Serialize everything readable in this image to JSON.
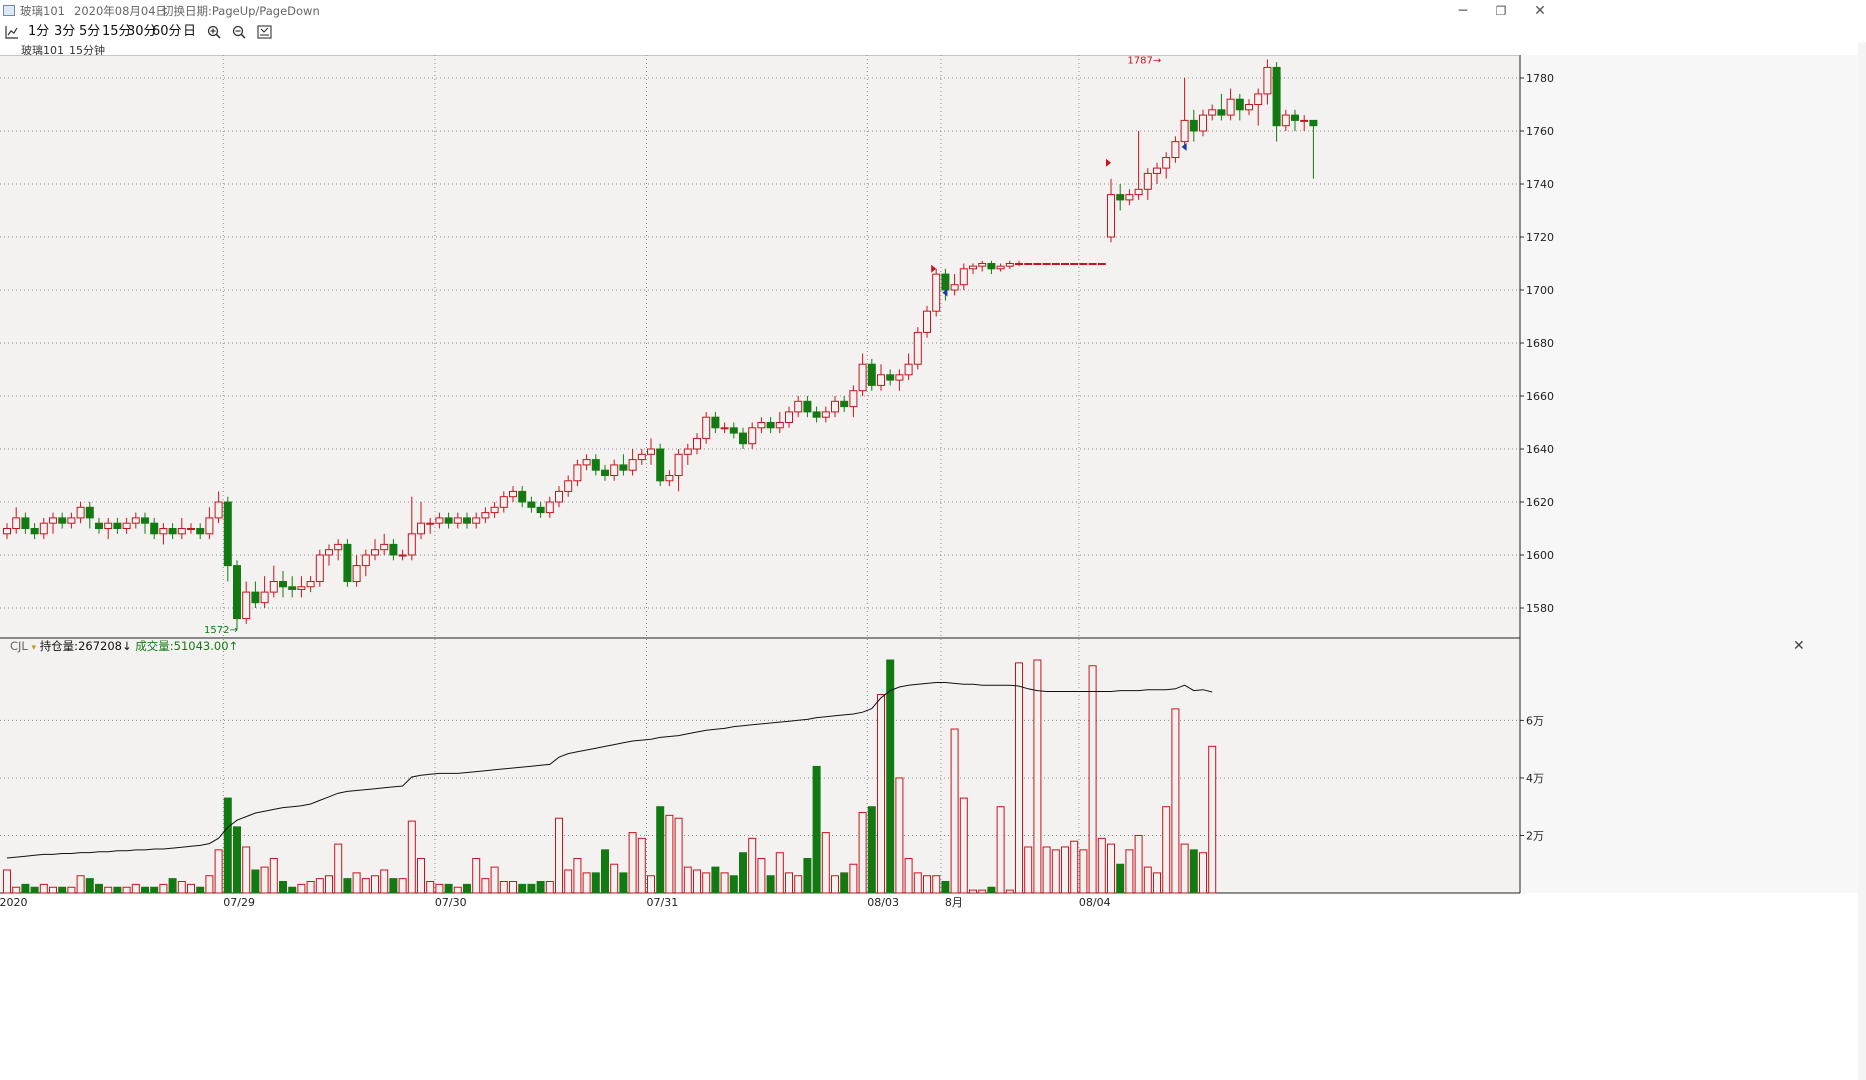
{
  "window": {
    "symbol": "玻璃101",
    "date": "2020年08月04日",
    "hint": "切换日期:PageUp/PageDown",
    "minimize": "─",
    "restore": "❐",
    "close": "✕"
  },
  "toolbar": {
    "chart_icon": "chart-line-icon",
    "periods": [
      "1分",
      "3分",
      "5分",
      "15分",
      "30分",
      "60分",
      "日"
    ],
    "zoom_in_icon": "zoom-in-icon",
    "zoom_out_icon": "zoom-out-icon",
    "fit_icon": "fit-screen-icon"
  },
  "subbar": {
    "symbol": "玻璃101",
    "period": "15分钟"
  },
  "volume_panel": {
    "indicator": "CJL",
    "oi_label": "持仓量:",
    "oi_value": "267208",
    "oi_arrow": "↓",
    "vol_label": "成交量:",
    "vol_value": "51043.00",
    "vol_arrow": "↑",
    "close_icon": "✕"
  },
  "colors": {
    "up": "#c8141e",
    "down": "#137a13",
    "background": "#f3f2f0",
    "grid": "#888888"
  },
  "chart_data": [
    {
      "type": "candlestick",
      "x_labels": [
        "2020",
        "07/29",
        "07/30",
        "07/31",
        "08/03",
        "8月",
        "08/04"
      ],
      "y_ticks": [
        1580,
        1600,
        1620,
        1640,
        1660,
        1680,
        1700,
        1720,
        1740,
        1760,
        1780
      ],
      "ylim": [
        1570,
        1791
      ],
      "grid": true,
      "annotations": [
        {
          "text": "1787→",
          "value": 1787
        },
        {
          "text": "1572→",
          "value": 1572
        }
      ],
      "candles": [
        [
          1608,
          1610,
          1606,
          1612
        ],
        [
          1610,
          1614,
          1608,
          1618
        ],
        [
          1614,
          1610,
          1608,
          1616
        ],
        [
          1610,
          1608,
          1606,
          1612
        ],
        [
          1608,
          1612,
          1606,
          1614
        ],
        [
          1612,
          1614,
          1608,
          1616
        ],
        [
          1614,
          1612,
          1610,
          1616
        ],
        [
          1612,
          1614,
          1610,
          1616
        ],
        [
          1614,
          1618,
          1612,
          1620
        ],
        [
          1618,
          1614,
          1610,
          1620
        ],
        [
          1612,
          1610,
          1608,
          1614
        ],
        [
          1610,
          1612,
          1606,
          1614
        ],
        [
          1612,
          1610,
          1608,
          1614
        ],
        [
          1610,
          1612,
          1608,
          1614
        ],
        [
          1612,
          1614,
          1610,
          1616
        ],
        [
          1614,
          1612,
          1608,
          1616
        ],
        [
          1612,
          1608,
          1606,
          1614
        ],
        [
          1608,
          1610,
          1604,
          1612
        ],
        [
          1610,
          1608,
          1606,
          1612
        ],
        [
          1608,
          1610,
          1606,
          1614
        ],
        [
          1610,
          1610,
          1608,
          1612
        ],
        [
          1610,
          1608,
          1606,
          1612
        ],
        [
          1608,
          1614,
          1606,
          1618
        ],
        [
          1614,
          1620,
          1612,
          1624
        ],
        [
          1620,
          1596,
          1590,
          1622
        ],
        [
          1596,
          1576,
          1572,
          1598
        ],
        [
          1576,
          1586,
          1574,
          1590
        ],
        [
          1586,
          1582,
          1580,
          1590
        ],
        [
          1582,
          1586,
          1580,
          1592
        ],
        [
          1586,
          1590,
          1584,
          1596
        ],
        [
          1590,
          1588,
          1584,
          1594
        ],
        [
          1588,
          1587,
          1584,
          1592
        ],
        [
          1587,
          1588,
          1584,
          1592
        ],
        [
          1588,
          1590,
          1586,
          1592
        ],
        [
          1590,
          1600,
          1588,
          1602
        ],
        [
          1600,
          1602,
          1596,
          1604
        ],
        [
          1602,
          1604,
          1598,
          1606
        ],
        [
          1604,
          1590,
          1588,
          1606
        ],
        [
          1590,
          1596,
          1588,
          1600
        ],
        [
          1596,
          1600,
          1592,
          1602
        ],
        [
          1600,
          1602,
          1598,
          1606
        ],
        [
          1602,
          1604,
          1600,
          1608
        ],
        [
          1604,
          1600,
          1598,
          1606
        ],
        [
          1600,
          1600,
          1598,
          1602
        ],
        [
          1600,
          1608,
          1598,
          1622
        ],
        [
          1608,
          1612,
          1606,
          1620
        ],
        [
          1612,
          1612,
          1608,
          1614
        ],
        [
          1612,
          1614,
          1610,
          1616
        ],
        [
          1614,
          1612,
          1610,
          1616
        ],
        [
          1612,
          1614,
          1610,
          1616
        ],
        [
          1614,
          1612,
          1610,
          1616
        ],
        [
          1612,
          1614,
          1610,
          1616
        ],
        [
          1614,
          1616,
          1612,
          1618
        ],
        [
          1616,
          1618,
          1614,
          1620
        ],
        [
          1618,
          1622,
          1616,
          1624
        ],
        [
          1622,
          1624,
          1620,
          1626
        ],
        [
          1624,
          1620,
          1618,
          1626
        ],
        [
          1620,
          1618,
          1616,
          1622
        ],
        [
          1618,
          1616,
          1614,
          1620
        ],
        [
          1616,
          1620,
          1614,
          1622
        ],
        [
          1620,
          1624,
          1618,
          1626
        ],
        [
          1624,
          1628,
          1622,
          1630
        ],
        [
          1628,
          1634,
          1626,
          1636
        ],
        [
          1634,
          1636,
          1632,
          1638
        ],
        [
          1636,
          1632,
          1630,
          1638
        ],
        [
          1632,
          1630,
          1628,
          1634
        ],
        [
          1630,
          1634,
          1628,
          1636
        ],
        [
          1634,
          1632,
          1630,
          1638
        ],
        [
          1632,
          1636,
          1630,
          1640
        ],
        [
          1636,
          1638,
          1634,
          1640
        ],
        [
          1638,
          1640,
          1634,
          1644
        ],
        [
          1640,
          1628,
          1626,
          1642
        ],
        [
          1628,
          1630,
          1626,
          1632
        ],
        [
          1630,
          1638,
          1624,
          1640
        ],
        [
          1638,
          1640,
          1634,
          1642
        ],
        [
          1640,
          1644,
          1638,
          1646
        ],
        [
          1644,
          1652,
          1642,
          1654
        ],
        [
          1652,
          1648,
          1646,
          1654
        ],
        [
          1648,
          1648,
          1646,
          1650
        ],
        [
          1648,
          1646,
          1644,
          1650
        ],
        [
          1646,
          1642,
          1640,
          1648
        ],
        [
          1642,
          1648,
          1640,
          1650
        ],
        [
          1648,
          1650,
          1646,
          1652
        ],
        [
          1650,
          1648,
          1646,
          1652
        ],
        [
          1648,
          1650,
          1646,
          1654
        ],
        [
          1650,
          1654,
          1648,
          1656
        ],
        [
          1654,
          1658,
          1652,
          1660
        ],
        [
          1658,
          1654,
          1652,
          1660
        ],
        [
          1654,
          1652,
          1650,
          1656
        ],
        [
          1652,
          1654,
          1650,
          1656
        ],
        [
          1654,
          1658,
          1652,
          1660
        ],
        [
          1658,
          1656,
          1654,
          1660
        ],
        [
          1656,
          1662,
          1652,
          1664
        ],
        [
          1662,
          1672,
          1660,
          1676
        ],
        [
          1672,
          1664,
          1662,
          1674
        ],
        [
          1664,
          1668,
          1662,
          1672
        ],
        [
          1668,
          1666,
          1664,
          1670
        ],
        [
          1666,
          1668,
          1662,
          1670
        ],
        [
          1668,
          1672,
          1666,
          1676
        ],
        [
          1672,
          1684,
          1670,
          1686
        ],
        [
          1684,
          1692,
          1682,
          1694
        ],
        [
          1692,
          1706,
          1690,
          1708
        ],
        [
          1706,
          1700,
          1696,
          1708
        ],
        [
          1700,
          1702,
          1698,
          1706
        ],
        [
          1702,
          1708,
          1700,
          1710
        ],
        [
          1708,
          1709,
          1706,
          1710
        ],
        [
          1709,
          1710,
          1707,
          1711
        ],
        [
          1710,
          1708,
          1706,
          1711
        ],
        [
          1708,
          1709,
          1707,
          1710
        ],
        [
          1709,
          1710,
          1708,
          1711
        ],
        [
          1710,
          1710,
          1709,
          1711
        ],
        [
          1710,
          1710,
          1710,
          1710
        ],
        [
          1710,
          1710,
          1710,
          1710
        ],
        [
          1710,
          1710,
          1710,
          1710
        ],
        [
          1710,
          1710,
          1710,
          1710
        ],
        [
          1710,
          1710,
          1710,
          1710
        ],
        [
          1710,
          1710,
          1710,
          1710
        ],
        [
          1710,
          1710,
          1710,
          1710
        ],
        [
          1710,
          1710,
          1710,
          1710
        ],
        [
          1710,
          1710,
          1710,
          1710
        ],
        [
          1720,
          1736,
          1718,
          1742
        ],
        [
          1736,
          1734,
          1730,
          1740
        ],
        [
          1734,
          1736,
          1732,
          1738
        ],
        [
          1736,
          1738,
          1734,
          1760
        ],
        [
          1738,
          1744,
          1734,
          1746
        ],
        [
          1744,
          1746,
          1740,
          1748
        ],
        [
          1746,
          1750,
          1742,
          1752
        ],
        [
          1750,
          1756,
          1748,
          1758
        ],
        [
          1756,
          1764,
          1754,
          1780
        ],
        [
          1764,
          1760,
          1756,
          1768
        ],
        [
          1760,
          1766,
          1758,
          1768
        ],
        [
          1766,
          1768,
          1764,
          1770
        ],
        [
          1768,
          1766,
          1764,
          1774
        ],
        [
          1766,
          1772,
          1764,
          1776
        ],
        [
          1772,
          1768,
          1764,
          1774
        ],
        [
          1768,
          1770,
          1766,
          1772
        ],
        [
          1770,
          1774,
          1762,
          1776
        ],
        [
          1774,
          1784,
          1770,
          1787
        ],
        [
          1784,
          1762,
          1756,
          1786
        ],
        [
          1762,
          1766,
          1760,
          1768
        ],
        [
          1766,
          1764,
          1760,
          1768
        ],
        [
          1764,
          1764,
          1760,
          1766
        ],
        [
          1764,
          1762,
          1742,
          1764
        ]
      ]
    },
    {
      "type": "bar+line",
      "indicator": "CJL",
      "y_ticks": [
        "2万",
        "4万",
        "6万"
      ],
      "y_tick_values": [
        20000,
        40000,
        60000
      ],
      "ylim": [
        0,
        82000
      ],
      "volume": [
        8000,
        2000,
        3000,
        2000,
        3000,
        2000,
        2000,
        2000,
        6000,
        5000,
        3000,
        2000,
        2000,
        2000,
        3000,
        2000,
        2000,
        3000,
        5000,
        4000,
        3000,
        2000,
        6000,
        15000,
        33000,
        23000,
        16000,
        8000,
        9000,
        12000,
        4000,
        2000,
        3000,
        4000,
        5000,
        6000,
        17000,
        5000,
        7000,
        5000,
        6000,
        8000,
        5000,
        5000,
        25000,
        12000,
        4000,
        3000,
        3000,
        2000,
        3000,
        12000,
        5000,
        9000,
        4000,
        4000,
        3000,
        3000,
        4000,
        4000,
        26000,
        8000,
        12000,
        7000,
        7000,
        15000,
        10000,
        7000,
        21000,
        19000,
        6000,
        30000,
        27000,
        26000,
        9000,
        8000,
        7000,
        9000,
        7000,
        6000,
        14000,
        19000,
        12000,
        6000,
        14000,
        7000,
        6000,
        12000,
        44000,
        21000,
        6000,
        7000,
        10000,
        28000,
        30000,
        69000,
        81000,
        40000,
        12000,
        7000,
        6000,
        6000,
        4000,
        57000,
        33000,
        1000,
        1000,
        2000,
        30000,
        1000,
        80000,
        16000,
        81000,
        16000,
        15000,
        16000,
        18000,
        15000,
        79000,
        19000,
        17000,
        10000,
        15000,
        20000,
        9000,
        7000,
        30000,
        64000,
        17000,
        15000,
        14000,
        51000
      ],
      "open_interest": [
        175000,
        175500,
        176000,
        176500,
        177000,
        177000,
        177500,
        177500,
        178000,
        178000,
        178500,
        178500,
        179000,
        179000,
        179500,
        179500,
        180000,
        180000,
        180500,
        181000,
        181500,
        182000,
        183000,
        186000,
        192000,
        196000,
        198000,
        200000,
        201000,
        202000,
        203000,
        203500,
        204000,
        205000,
        207000,
        209000,
        211000,
        212000,
        212500,
        213000,
        213500,
        214000,
        214500,
        215000,
        220000,
        221000,
        221500,
        222000,
        222000,
        222000,
        222500,
        223000,
        223500,
        224000,
        224500,
        225000,
        225500,
        226000,
        226500,
        227000,
        231000,
        233000,
        234000,
        235000,
        236000,
        237000,
        238000,
        239000,
        240000,
        240500,
        241000,
        242000,
        242500,
        243000,
        244000,
        245000,
        246000,
        246500,
        247000,
        248000,
        248500,
        249000,
        249500,
        250000,
        250500,
        251000,
        251500,
        252000,
        253000,
        253500,
        254000,
        254500,
        255000,
        256000,
        258000,
        264000,
        268000,
        270000,
        271000,
        271500,
        272000,
        272500,
        272500,
        272000,
        271500,
        271500,
        271000,
        271000,
        271000,
        271000,
        270500,
        269000,
        268000,
        267500,
        267500,
        267500,
        267500,
        267500,
        267500,
        267500,
        267500,
        268000,
        268000,
        268000,
        268500,
        268500,
        268500,
        269000,
        271000,
        268000,
        268500,
        267208
      ]
    }
  ]
}
